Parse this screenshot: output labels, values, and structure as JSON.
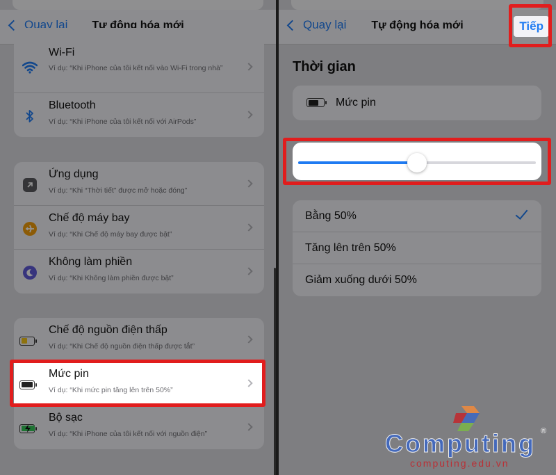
{
  "left": {
    "nav": {
      "back_label": "Quay lại",
      "title": "Tự động hóa mới"
    },
    "groups": [
      [
        {
          "title": "Wi-Fi",
          "subtitle": "Ví dụ: “Khi iPhone của tôi kết nối vào Wi-Fi trong nhà”",
          "icon": "wifi-icon"
        },
        {
          "title": "Bluetooth",
          "subtitle": "Ví dụ: “Khi iPhone của tôi kết nối với AirPods”",
          "icon": "bluetooth-icon"
        }
      ],
      [
        {
          "title": "Ứng dụng",
          "subtitle": "Ví dụ: “Khi “Thời tiết” được mở hoặc đóng”",
          "icon": "app-icon"
        },
        {
          "title": "Chế độ máy bay",
          "subtitle": "Ví dụ: “Khi Chế độ máy bay được bật”",
          "icon": "airplane-icon"
        },
        {
          "title": "Không làm phiền",
          "subtitle": "Ví dụ: “Khi Không làm phiền được bật”",
          "icon": "moon-icon"
        }
      ],
      [
        {
          "title": "Chế độ nguồn điện thấp",
          "subtitle": "Ví dụ: “Khi Chế độ nguồn điện thấp được tắt”",
          "icon": "low-power-battery-icon"
        },
        {
          "title": "Mức pin",
          "subtitle": "Ví dụ: “Khi mức pin tăng lên trên 50%”",
          "icon": "battery-level-icon"
        },
        {
          "title": "Bộ sạc",
          "subtitle": "Ví dụ: “Khi iPhone của tôi kết nối với nguồn điện”",
          "icon": "charging-battery-icon"
        }
      ]
    ]
  },
  "right": {
    "nav": {
      "back_label": "Quay lại",
      "title": "Tự động hóa mới",
      "next_label": "Tiếp"
    },
    "section_title": "Thời gian",
    "battery_card_label": "Mức pin",
    "slider_value": 0.5,
    "options": [
      {
        "label": "Bằng 50%",
        "selected": true
      },
      {
        "label": "Tăng lên trên 50%",
        "selected": false
      },
      {
        "label": "Giảm xuống dưới 50%",
        "selected": false
      }
    ]
  },
  "watermark": {
    "brand": "Computing",
    "domain": "computing.edu.vn"
  },
  "colors": {
    "accent": "#1f7bf2",
    "highlight": "#e11d1d",
    "brand_blue": "#3e67c2",
    "low_power": "#f5c518",
    "charging": "#34c759"
  }
}
